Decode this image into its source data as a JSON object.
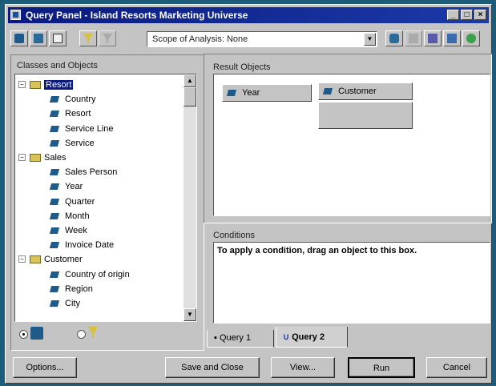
{
  "window": {
    "title": "Query Panel - Island Resorts Marketing Universe"
  },
  "toolbar": {
    "scope_label": "Scope of Analysis: None"
  },
  "classes_panel": {
    "label": "Classes and Objects",
    "tree": [
      {
        "kind": "class",
        "label": "Resort",
        "selected": true
      },
      {
        "kind": "object",
        "label": "Country"
      },
      {
        "kind": "object",
        "label": "Resort"
      },
      {
        "kind": "object",
        "label": "Service Line"
      },
      {
        "kind": "object",
        "label": "Service"
      },
      {
        "kind": "class",
        "label": "Sales"
      },
      {
        "kind": "object",
        "label": "Sales Person"
      },
      {
        "kind": "object",
        "label": "Year"
      },
      {
        "kind": "object",
        "label": "Quarter"
      },
      {
        "kind": "object",
        "label": "Month"
      },
      {
        "kind": "object",
        "label": "Week"
      },
      {
        "kind": "object",
        "label": "Invoice Date"
      },
      {
        "kind": "class",
        "label": "Customer"
      },
      {
        "kind": "object",
        "label": "Country of origin"
      },
      {
        "kind": "object",
        "label": "Region"
      },
      {
        "kind": "object",
        "label": "City"
      }
    ]
  },
  "result_objects": {
    "label": "Result Objects",
    "items": [
      "Year",
      "Customer"
    ]
  },
  "conditions": {
    "label": "Conditions",
    "hint": "To apply a condition, drag an object to this box."
  },
  "tabs": [
    {
      "label": "Query 1",
      "active": false
    },
    {
      "label": "Query 2",
      "active": true
    }
  ],
  "buttons": {
    "options": "Options...",
    "save_close": "Save and Close",
    "view": "View...",
    "run": "Run",
    "cancel": "Cancel"
  }
}
